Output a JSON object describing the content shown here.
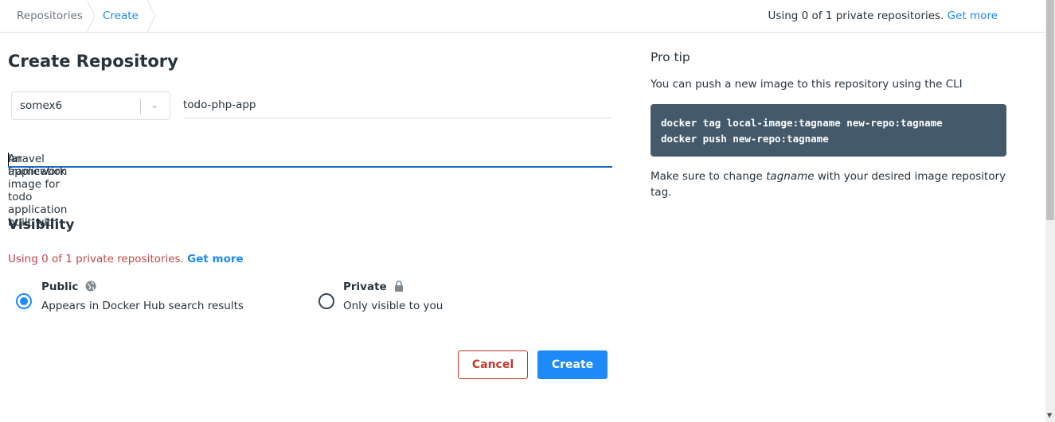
{
  "breadcrumb": {
    "items": [
      "Repositories",
      "Create"
    ]
  },
  "header": {
    "usage_text": "Using 0 of 1 private repositories.",
    "get_more": "Get more"
  },
  "form": {
    "title": "Create Repository",
    "namespace": "somex6",
    "repo_name": "todo-php-app",
    "description_before": "An application image for todo application built with",
    "description_after": "laravel framework",
    "visibility_title": "Visibility",
    "usage_text": "Using 0 of 1 private repositories.",
    "get_more": "Get more",
    "options": [
      {
        "title": "Public",
        "subtitle": "Appears in Docker Hub search results",
        "selected": true
      },
      {
        "title": "Private",
        "subtitle": "Only visible to you",
        "selected": false
      }
    ],
    "cancel": "Cancel",
    "create": "Create"
  },
  "tip": {
    "title": "Pro tip",
    "text": "You can push a new image to this repository using the CLI",
    "code": [
      "docker tag local-image:tagname new-repo:tagname",
      "docker push new-repo:tagname"
    ],
    "note_before": "Make sure to change ",
    "note_em": "tagname",
    "note_after": " with your desired image repository tag."
  },
  "colors": {
    "accent": "#1d8af7",
    "danger": "#c0392b",
    "code_bg": "#445a6b"
  }
}
